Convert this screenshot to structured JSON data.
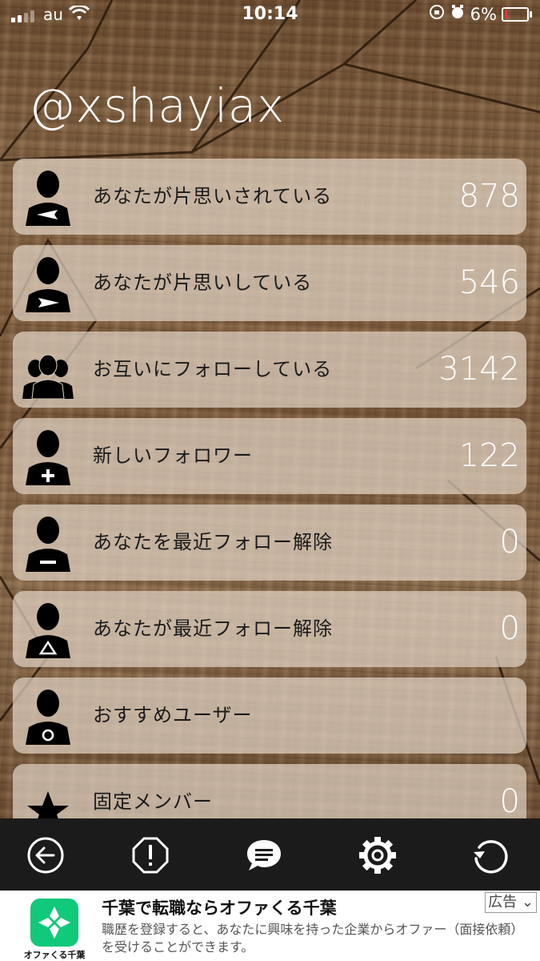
{
  "status_bar": {
    "carrier": "au",
    "time": "10:14",
    "battery": "6%"
  },
  "header": {
    "username": "@xshayiax"
  },
  "rows": [
    {
      "label": "あなたが片思いされている",
      "count": "878",
      "icon": "person-arrow-left-icon"
    },
    {
      "label": "あなたが片思いしている",
      "count": "546",
      "icon": "person-arrow-right-icon"
    },
    {
      "label": "お互いにフォローしている",
      "count": "3142",
      "icon": "group-icon"
    },
    {
      "label": "新しいフォロワー",
      "count": "122",
      "icon": "person-plus-icon"
    },
    {
      "label": "あなたを最近フォロー解除",
      "count": "0",
      "icon": "person-minus-icon"
    },
    {
      "label": "あなたが最近フォロー解除",
      "count": "0",
      "icon": "person-triangle-icon"
    },
    {
      "label": "おすすめユーザー",
      "count": "",
      "icon": "person-circle-icon"
    },
    {
      "label": "固定メンバー",
      "count": "0",
      "icon": "star-icon"
    }
  ],
  "toolbar": {
    "items": [
      "back-arrow-icon",
      "alert-octagon-icon",
      "chat-bubble-icon",
      "gear-icon",
      "refresh-icon"
    ]
  },
  "ad": {
    "headline": "千葉で転職ならオファくる千葉",
    "description": "職歴を登録すると、あなたに興味を持った企業からオファー（面接依頼）を受けることができます。",
    "logo_text": "オファくる千葉",
    "badge": "広告"
  },
  "colors": {
    "toolbar": "#1b1b1b",
    "row_bg": "#e1d2c3",
    "ad_logo": "#10c97a"
  }
}
